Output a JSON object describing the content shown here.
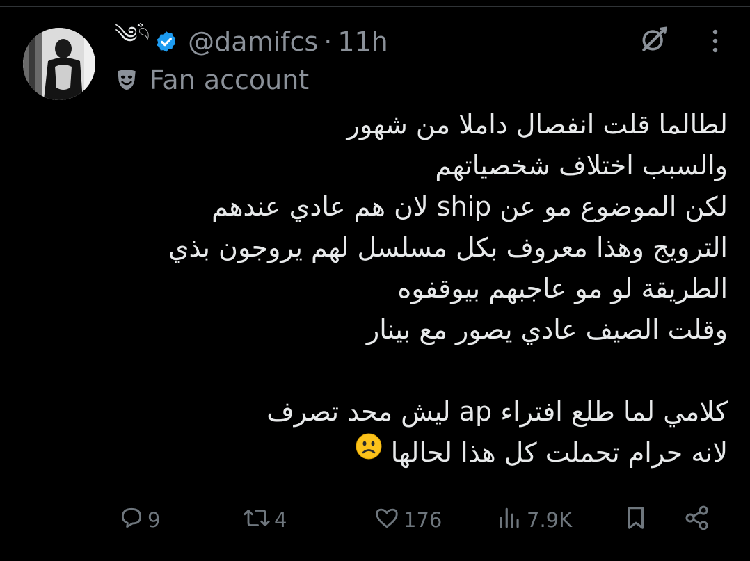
{
  "tweet": {
    "display_name": "༄ࣽ𓄹",
    "handle": "@damifcs",
    "separator": "·",
    "time": "11h",
    "label": "Fan account",
    "lines": [
      "لطالما قلت انفصال داملا من شهور",
      "والسبب اختلاف شخصياتهم",
      "لكن الموضوع مو عن ship لان هم عادي عندهم",
      "الترويج وهذا معروف بكل مسلسل لهم يروجون بذي",
      "الطريقة لو مو عاجبهم بيوقفوه",
      "وقلت الصيف عادي يصور مع بينار",
      "",
      "كلامي لما طلع افتراء ap ليش محد تصرف",
      "لانه حرام تحملت كل هذا لحالها"
    ],
    "emoji": "frowning-face"
  },
  "actions": {
    "replies": "9",
    "reposts": "4",
    "likes": "176",
    "views": "7.9K"
  },
  "colors": {
    "background": "#000000",
    "text": "#e7e9ea",
    "muted": "#8b9199",
    "verified": "#1d9bf0",
    "action": "#6e767d"
  },
  "icons": {
    "verified": "verified-badge-icon",
    "label": "theater-mask-icon",
    "grok": "grok-icon",
    "more": "more-vertical-icon",
    "reply": "reply-icon",
    "repost": "repost-icon",
    "like": "heart-icon",
    "views": "views-chart-icon",
    "bookmark": "bookmark-icon",
    "share": "share-icon"
  }
}
